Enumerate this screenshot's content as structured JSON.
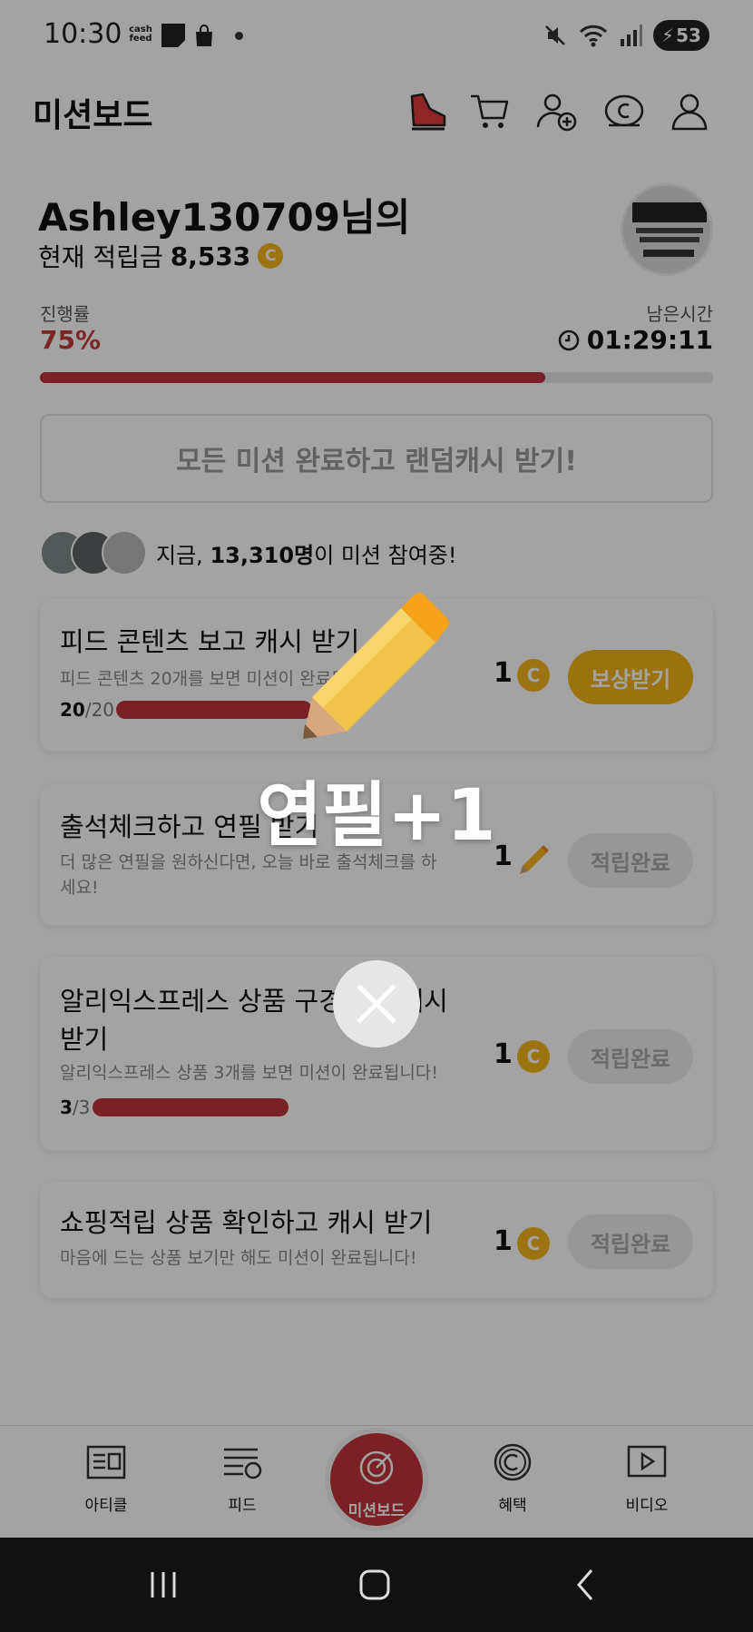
{
  "status_bar": {
    "time": "10:30",
    "app_badge": "cash feed",
    "battery": "53"
  },
  "header": {
    "title": "미션보드",
    "icons": [
      "shoe-icon",
      "cart-icon",
      "add-friend-icon",
      "cash-coin-icon",
      "profile-icon"
    ]
  },
  "user": {
    "greeting": "Ashley130709님의",
    "balance_label": "현재 적립금",
    "balance_value": "8,533",
    "coin_symbol": "C"
  },
  "progress": {
    "label": "진행률",
    "value": "75%",
    "fraction": 0.75,
    "remaining_label": "남은시간",
    "remaining_value": "01:29:11"
  },
  "all_missions_button": "모든 미션 완료하고 랜덤캐시 받기!",
  "participants": {
    "prefix": "지금,",
    "count": "13,310명",
    "suffix": "이 미션 참여중!"
  },
  "missions": [
    {
      "title": "피드 콘텐츠 보고 캐시 받기",
      "desc": "피드 콘텐츠 20개를 보면 미션이 완료됩니다!",
      "count_done": "20",
      "count_total": "/20",
      "progress_fraction": 1.0,
      "reward": "1",
      "reward_icon": "coin-icon",
      "button": "보상받기"
    },
    {
      "title": "출석체크하고 연필 받기",
      "desc": "더 많은 연필을 원하신다면, 오늘 바로 출석체크를 하세요!",
      "reward": "1",
      "reward_icon": "pencil-icon",
      "button": "적립완료"
    },
    {
      "title": "알리익스프레스 상품 구경하고 캐시받기",
      "desc": "알리익스프레스 상품 3개를 보면 미션이 완료됩니다!",
      "count_done": "3",
      "count_total": "/3",
      "progress_fraction": 1.0,
      "reward": "1",
      "reward_icon": "coin-icon",
      "button": "적립완료"
    },
    {
      "title": "쇼핑적립 상품 확인하고 캐시 받기",
      "desc": "마음에 드는 상품 보기만 해도 미션이 완료됩니다!",
      "reward": "1",
      "reward_icon": "coin-icon",
      "button": "적립완료"
    }
  ],
  "bottom_nav": {
    "items": [
      "아티클",
      "피드",
      "미션보드",
      "혜택",
      "비디오"
    ]
  },
  "overlay": {
    "text": "연필+1"
  },
  "colors": {
    "accent_red": "#c0343a",
    "coin_gold": "#f3b41a",
    "claim_button": "#f2b516"
  }
}
